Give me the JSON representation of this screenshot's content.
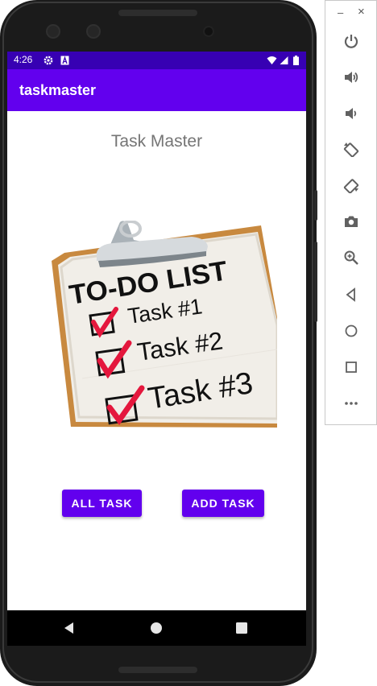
{
  "status_bar": {
    "time": "4:26",
    "background": "#3700b3"
  },
  "app_bar": {
    "title": "taskmaster",
    "background": "#6200ee"
  },
  "main": {
    "heading": "Task Master",
    "image": {
      "list_title": "TO-DO LIST",
      "tasks": [
        "Task #1",
        "Task #2",
        "Task #3"
      ],
      "check_color": "#e4173d"
    },
    "buttons": {
      "all_task": "ALL TASK",
      "add_task": "ADD TASK",
      "color": "#6200ee"
    }
  },
  "nav_bar": {
    "items": [
      "back-icon",
      "home-icon",
      "recents-icon"
    ]
  },
  "emulator_toolbar": {
    "minimize": "–",
    "close": "×",
    "tools": [
      "power-icon",
      "volume-up-icon",
      "volume-down-icon",
      "rotate-left-icon",
      "rotate-right-icon",
      "camera-icon",
      "zoom-icon",
      "back-icon",
      "home-icon",
      "overview-icon",
      "more-icon"
    ]
  }
}
